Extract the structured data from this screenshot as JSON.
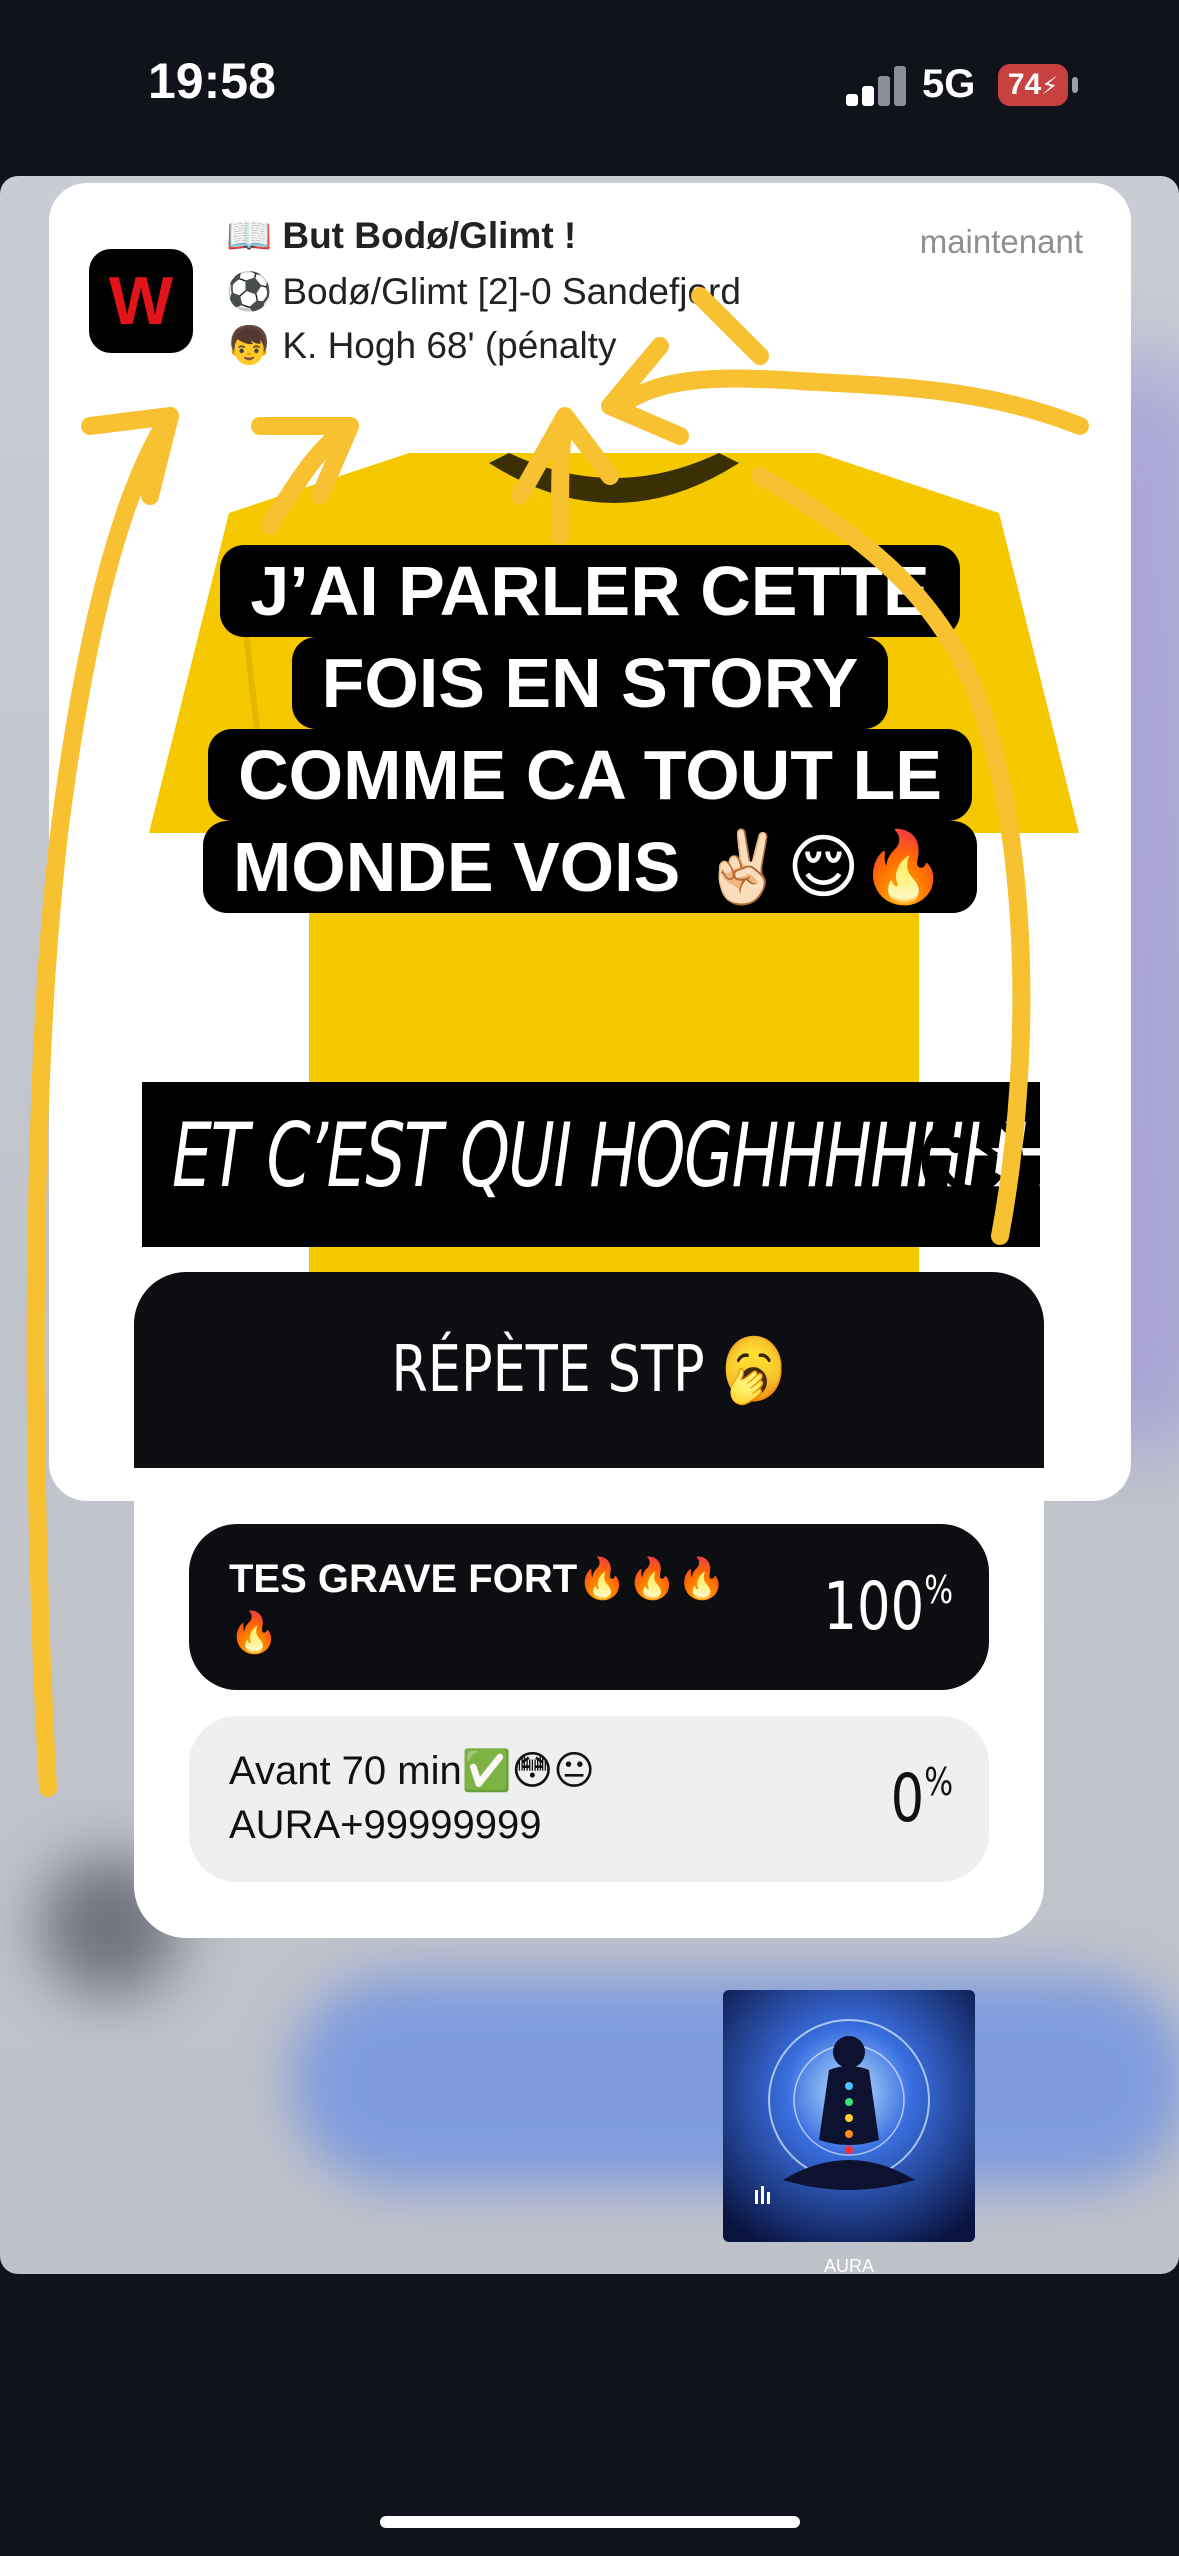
{
  "status_bar": {
    "time": "19:58",
    "network": "5G",
    "battery": "74"
  },
  "notification": {
    "app_icon": "W",
    "title": "📖 But Bodø/Glimt !",
    "line2": "⚽ Bodø/Glimt [2]-0 Sandefjord",
    "line3": "👦 K. Hogh 68' (pénalty",
    "timestamp": "maintenant"
  },
  "caption": {
    "line1": "J’AI PARLER CETTE",
    "line2": "FOIS EN STORY",
    "line3": "COMME CA TOUT LE",
    "line4": "MONDE VOIS ✌🏻😌🔥"
  },
  "hogh": {
    "text": "ET C’EST QUI HOGHHHHHHH",
    "emoji": "😉"
  },
  "quiz": {
    "question": "RÉPÈTE STP 🥱",
    "options": [
      {
        "label": "TES GRAVE FORT🔥🔥🔥🔥",
        "percent": "100",
        "unit": "%"
      },
      {
        "label": "Avant 70 min✅😳😐 AURA+99999999",
        "percent": "0",
        "unit": "%"
      }
    ]
  },
  "sticker": {
    "label": "AURA"
  },
  "colors": {
    "arrow": "#f7c132",
    "shirt": "#f5c800",
    "caption_bg": "#000000",
    "quiz_dark": "#0d0e12"
  }
}
